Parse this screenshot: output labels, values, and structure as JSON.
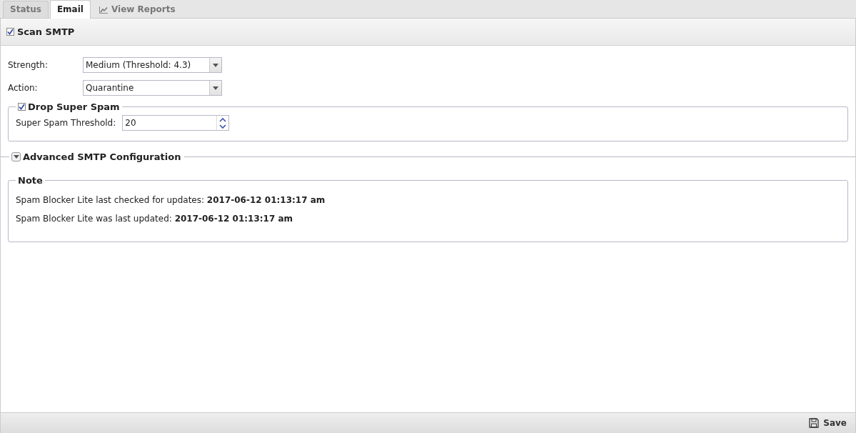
{
  "tabs": [
    {
      "label": "Status",
      "selected": false,
      "kind": "plain"
    },
    {
      "label": "Email",
      "selected": true,
      "kind": "plain"
    },
    {
      "label": "View Reports",
      "selected": false,
      "kind": "chart"
    }
  ],
  "scan_smtp": {
    "label": "Scan SMTP",
    "checked": true
  },
  "fields": [
    {
      "label": "Strength:",
      "value": "Medium (Threshold: 4.3)"
    },
    {
      "label": "Action:",
      "value": "Quarantine"
    }
  ],
  "drop_super_spam": {
    "label": "Drop Super Spam",
    "checked": true,
    "threshold": {
      "label": "Super Spam Threshold:",
      "value": "20"
    }
  },
  "advanced": {
    "label": "Advanced SMTP Configuration",
    "expanded": false
  },
  "note": {
    "title": "Note",
    "lines": [
      "Spam Blocker Lite last checked for updates: **2017-06-12 01:13:17 am**",
      "Spam Blocker Lite was last updated: **2017-06-12 01:13:17 am**"
    ]
  },
  "save_button": "Save"
}
